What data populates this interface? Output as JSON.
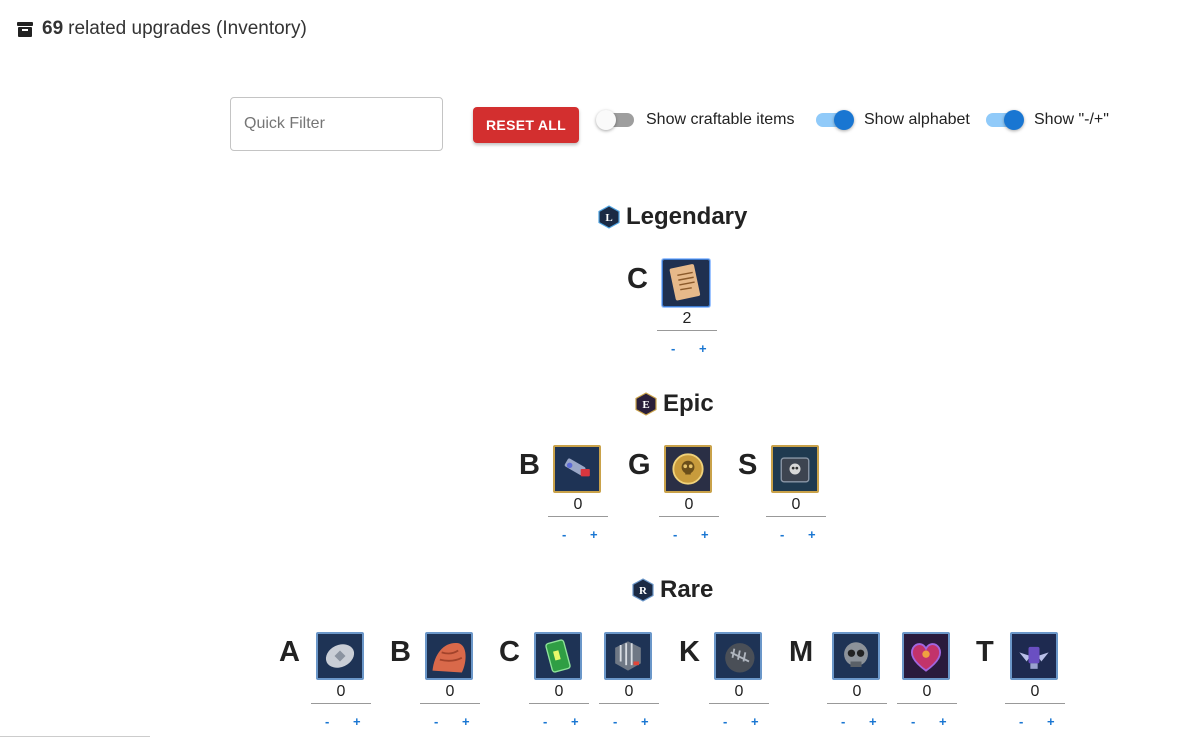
{
  "header": {
    "count": "69",
    "text": "related upgrades (Inventory)"
  },
  "controls": {
    "filter_placeholder": "Quick Filter",
    "reset_label": "RESET ALL",
    "toggles": [
      {
        "label": "Show craftable items",
        "on": false
      },
      {
        "label": "Show alphabet",
        "on": true
      },
      {
        "label": "Show \"-/+\"",
        "on": true
      }
    ]
  },
  "sections": [
    {
      "name": "Legendary",
      "badge_letter": "L",
      "groups": [
        {
          "letter": "C",
          "items": [
            {
              "icon": "scroll-icon",
              "count": "2"
            }
          ]
        }
      ]
    },
    {
      "name": "Epic",
      "badge_letter": "E",
      "groups": [
        {
          "letter": "B",
          "items": [
            {
              "icon": "blaster-icon",
              "count": "0"
            }
          ]
        },
        {
          "letter": "G",
          "items": [
            {
              "icon": "gold-skull-coin-icon",
              "count": "0"
            }
          ]
        },
        {
          "letter": "S",
          "items": [
            {
              "icon": "skull-chest-icon",
              "count": "0"
            }
          ]
        }
      ]
    },
    {
      "name": "Rare",
      "badge_letter": "R",
      "groups": [
        {
          "letter": "A",
          "items": [
            {
              "icon": "armor-plate-icon",
              "count": "0"
            }
          ]
        },
        {
          "letter": "B",
          "items": [
            {
              "icon": "muscle-icon",
              "count": "0"
            }
          ]
        },
        {
          "letter": "C",
          "items": [
            {
              "icon": "battery-cell-icon",
              "count": "0"
            },
            {
              "icon": "circuit-cube-icon",
              "count": "0"
            }
          ]
        },
        {
          "letter": "K",
          "items": [
            {
              "icon": "knuckle-icon",
              "count": "0"
            }
          ]
        },
        {
          "letter": "M",
          "items": [
            {
              "icon": "metal-skull-icon",
              "count": "0"
            },
            {
              "icon": "mech-heart-icon",
              "count": "0"
            }
          ]
        },
        {
          "letter": "T",
          "items": [
            {
              "icon": "trophy-wings-icon",
              "count": "0"
            }
          ]
        }
      ]
    }
  ],
  "stepper": {
    "minus": "-",
    "plus": "+"
  },
  "colors": {
    "accent": "#1976d2",
    "reset": "#d32f2f",
    "epic_border": "#c9a24a",
    "rare_border": "#6b97c9"
  }
}
